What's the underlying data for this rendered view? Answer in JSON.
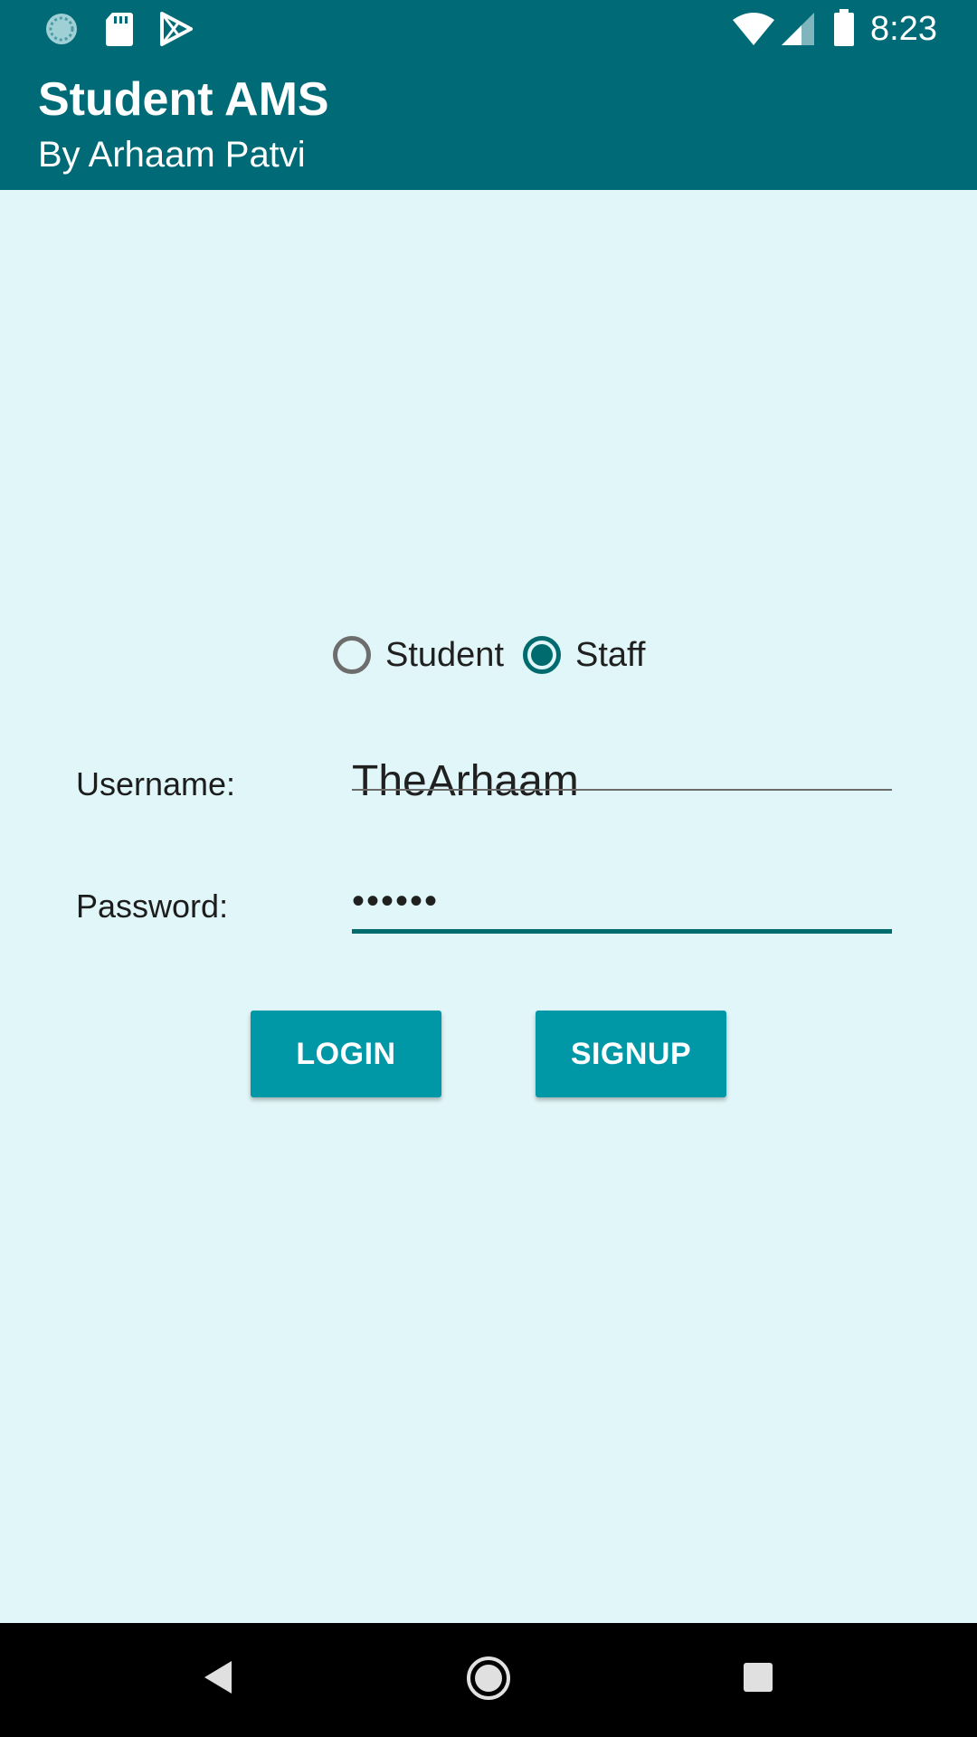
{
  "status_bar": {
    "time": "8:23",
    "icons_left": [
      "sync-icon",
      "sd-card-icon",
      "play-store-icon"
    ],
    "icons_right": [
      "wifi-icon",
      "cell-signal-icon",
      "battery-icon"
    ]
  },
  "app_bar": {
    "title": "Student AMS",
    "subtitle": "By Arhaam Patvi"
  },
  "role_selector": {
    "options": [
      {
        "label": "Student",
        "checked": false
      },
      {
        "label": "Staff",
        "checked": true
      }
    ]
  },
  "form": {
    "username_label": "Username:",
    "username_value": "TheArhaam",
    "password_label": "Password:",
    "password_value": "••••••"
  },
  "buttons": {
    "login": "LOGIN",
    "signup": "SIGNUP"
  },
  "nav_bar": {
    "icons": [
      "back-icon",
      "home-icon",
      "recents-icon"
    ]
  },
  "colors": {
    "primary_dark": "#006b77",
    "accent": "#0097a7",
    "background": "#e0f6f8"
  }
}
